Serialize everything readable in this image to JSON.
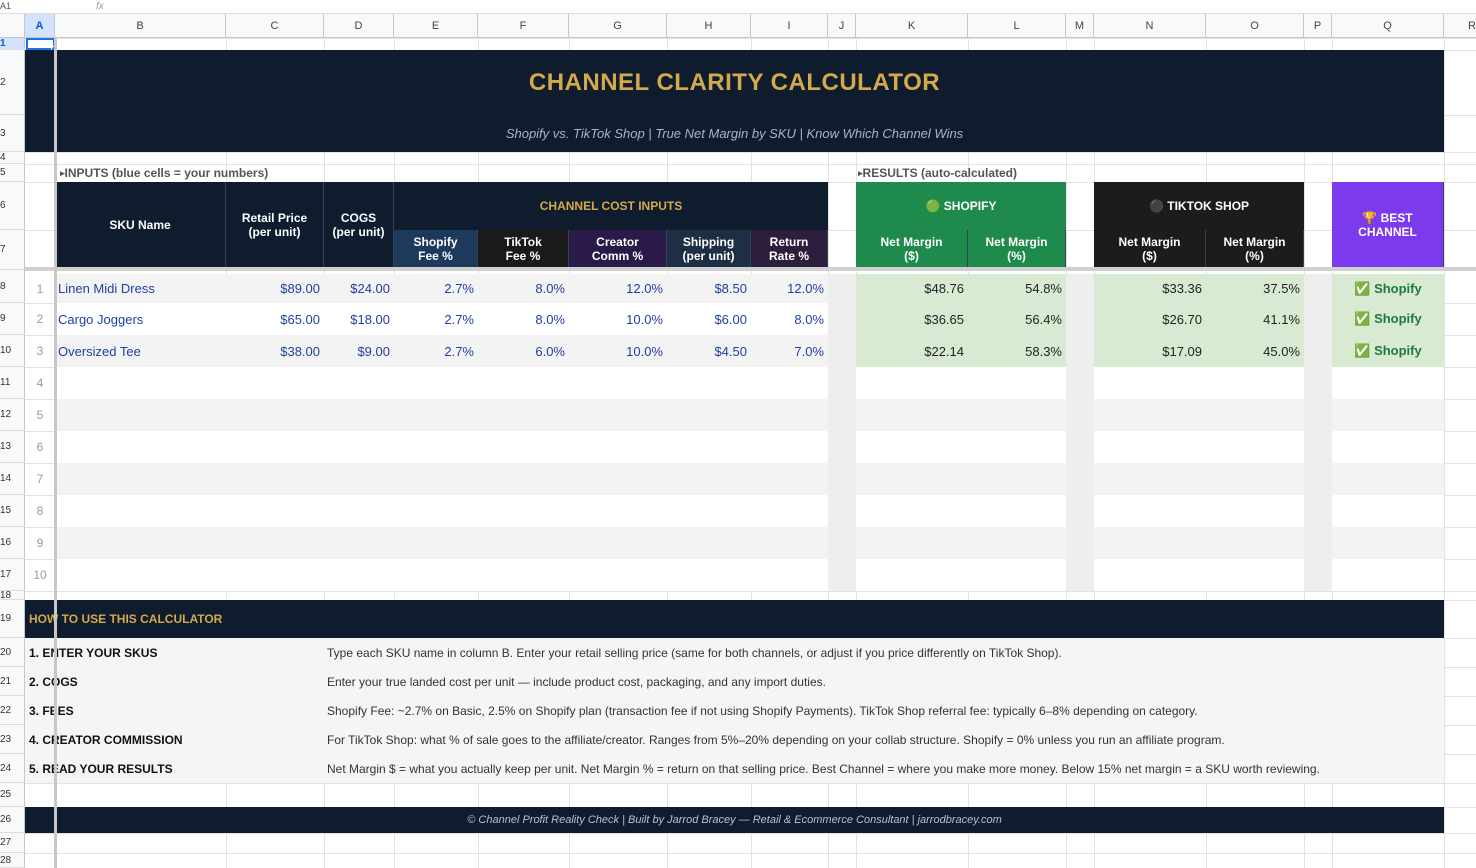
{
  "formula_bar": {
    "cell_ref": "A1",
    "fx_label": "fx"
  },
  "column_headers": [
    "A",
    "B",
    "C",
    "D",
    "E",
    "F",
    "G",
    "H",
    "I",
    "J",
    "K",
    "L",
    "M",
    "N",
    "O",
    "P",
    "Q",
    "R"
  ],
  "row_numbers": [
    "1",
    "2",
    "3",
    "4",
    "5",
    "6",
    "7",
    "8",
    "9",
    "10",
    "11",
    "12",
    "13",
    "14",
    "15",
    "16",
    "17",
    "18",
    "19",
    "20",
    "21",
    "22",
    "23",
    "24",
    "25",
    "26",
    "27",
    "28"
  ],
  "title": "CHANNEL CLARITY CALCULATOR",
  "subtitle": "Shopify vs. TikTok Shop  |  True Net Margin by SKU  |  Know Which Channel Wins",
  "inputs_label": "INPUTS  (blue cells = your numbers)",
  "results_label": "RESULTS  (auto-calculated)",
  "headers": {
    "sku_name": "SKU Name",
    "retail_price": [
      "Retail Price",
      "(per unit)"
    ],
    "cogs": [
      "COGS",
      "(per unit)"
    ],
    "channel_cost_inputs": "CHANNEL COST INPUTS",
    "shopify_fee": [
      "Shopify",
      "Fee %"
    ],
    "tiktok_fee": [
      "TikTok",
      "Fee %"
    ],
    "creator_comm": [
      "Creator",
      "Comm %"
    ],
    "shipping": [
      "Shipping",
      "(per unit)"
    ],
    "return_rate": [
      "Return",
      "Rate %"
    ],
    "shopify": "🟢 SHOPIFY",
    "tiktok_shop": "⚫ TIKTOK SHOP",
    "net_margin_dollar": [
      "Net Margin",
      "($)"
    ],
    "net_margin_pct": [
      "Net Margin",
      "(%)"
    ],
    "best_channel": [
      "🏆 BEST",
      "CHANNEL"
    ]
  },
  "colors": {
    "dark_navy": "#0f1c2e",
    "gold": "#d4a94a",
    "shopify_green": "#1e8a4c",
    "result_green": "#d9ead3",
    "tiktok_black": "#1c1c1c",
    "best_purple": "#7c3aed",
    "input_blue_text": "#1f3fa3",
    "shopify_fee_header": "#1d3a5c",
    "tiktok_fee_header": "#1a1a1a",
    "creator_header": "#2a1a4a",
    "shipping_header": "#1e2e44",
    "return_header": "#2e1e3e"
  },
  "rows": [
    {
      "idx": "1",
      "sku": "Linen Midi Dress",
      "retail": "$89.00",
      "cogs": "$24.00",
      "shopify_fee": "2.7%",
      "tiktok_fee": "8.0%",
      "creator": "12.0%",
      "shipping": "$8.50",
      "return_rate": "12.0%",
      "shopify_nm": "$48.76",
      "shopify_pct": "54.8%",
      "tiktok_nm": "$33.36",
      "tiktok_pct": "37.5%",
      "best": "✅ Shopify"
    },
    {
      "idx": "2",
      "sku": "Cargo Joggers",
      "retail": "$65.00",
      "cogs": "$18.00",
      "shopify_fee": "2.7%",
      "tiktok_fee": "8.0%",
      "creator": "10.0%",
      "shipping": "$6.00",
      "return_rate": "8.0%",
      "shopify_nm": "$36.65",
      "shopify_pct": "56.4%",
      "tiktok_nm": "$26.70",
      "tiktok_pct": "41.1%",
      "best": "✅ Shopify"
    },
    {
      "idx": "3",
      "sku": "Oversized Tee",
      "retail": "$38.00",
      "cogs": "$9.00",
      "shopify_fee": "2.7%",
      "tiktok_fee": "6.0%",
      "creator": "10.0%",
      "shipping": "$4.50",
      "return_rate": "7.0%",
      "shopify_nm": "$22.14",
      "shopify_pct": "58.3%",
      "tiktok_nm": "$17.09",
      "tiktok_pct": "45.0%",
      "best": "✅ Shopify"
    },
    {
      "idx": "4"
    },
    {
      "idx": "5"
    },
    {
      "idx": "6"
    },
    {
      "idx": "7"
    },
    {
      "idx": "8"
    },
    {
      "idx": "9"
    },
    {
      "idx": "10"
    }
  ],
  "how_to_title": "HOW TO USE THIS CALCULATOR",
  "how_to": [
    {
      "step": "1. ENTER YOUR SKUS",
      "text": "Type each SKU name in column B. Enter your retail selling price (same for both channels, or adjust if you price differently on TikTok Shop)."
    },
    {
      "step": "2. COGS",
      "text": "Enter your true landed cost per unit — include product cost, packaging, and any import duties."
    },
    {
      "step": "3. FEES",
      "text": "Shopify Fee: ~2.7% on Basic, 2.5% on Shopify plan (transaction fee if not using Shopify Payments). TikTok Shop referral fee: typically 6–8% depending on category."
    },
    {
      "step": "4. CREATOR COMMISSION",
      "text": "For TikTok Shop: what % of sale goes to the affiliate/creator. Ranges from 5%–20% depending on your collab structure. Shopify = 0% unless you run an affiliate program."
    },
    {
      "step": "5. READ YOUR RESULTS",
      "text": "Net Margin $ = what you actually keep per unit. Net Margin % = return on that selling price. Best Channel = where you make more money. Below 15% net margin = a SKU worth reviewing."
    }
  ],
  "footer": "© Channel Profit Reality Check  |  Built by Jarrod Bracey — Retail & Ecommerce Consultant  |  jarrodbracey.com"
}
